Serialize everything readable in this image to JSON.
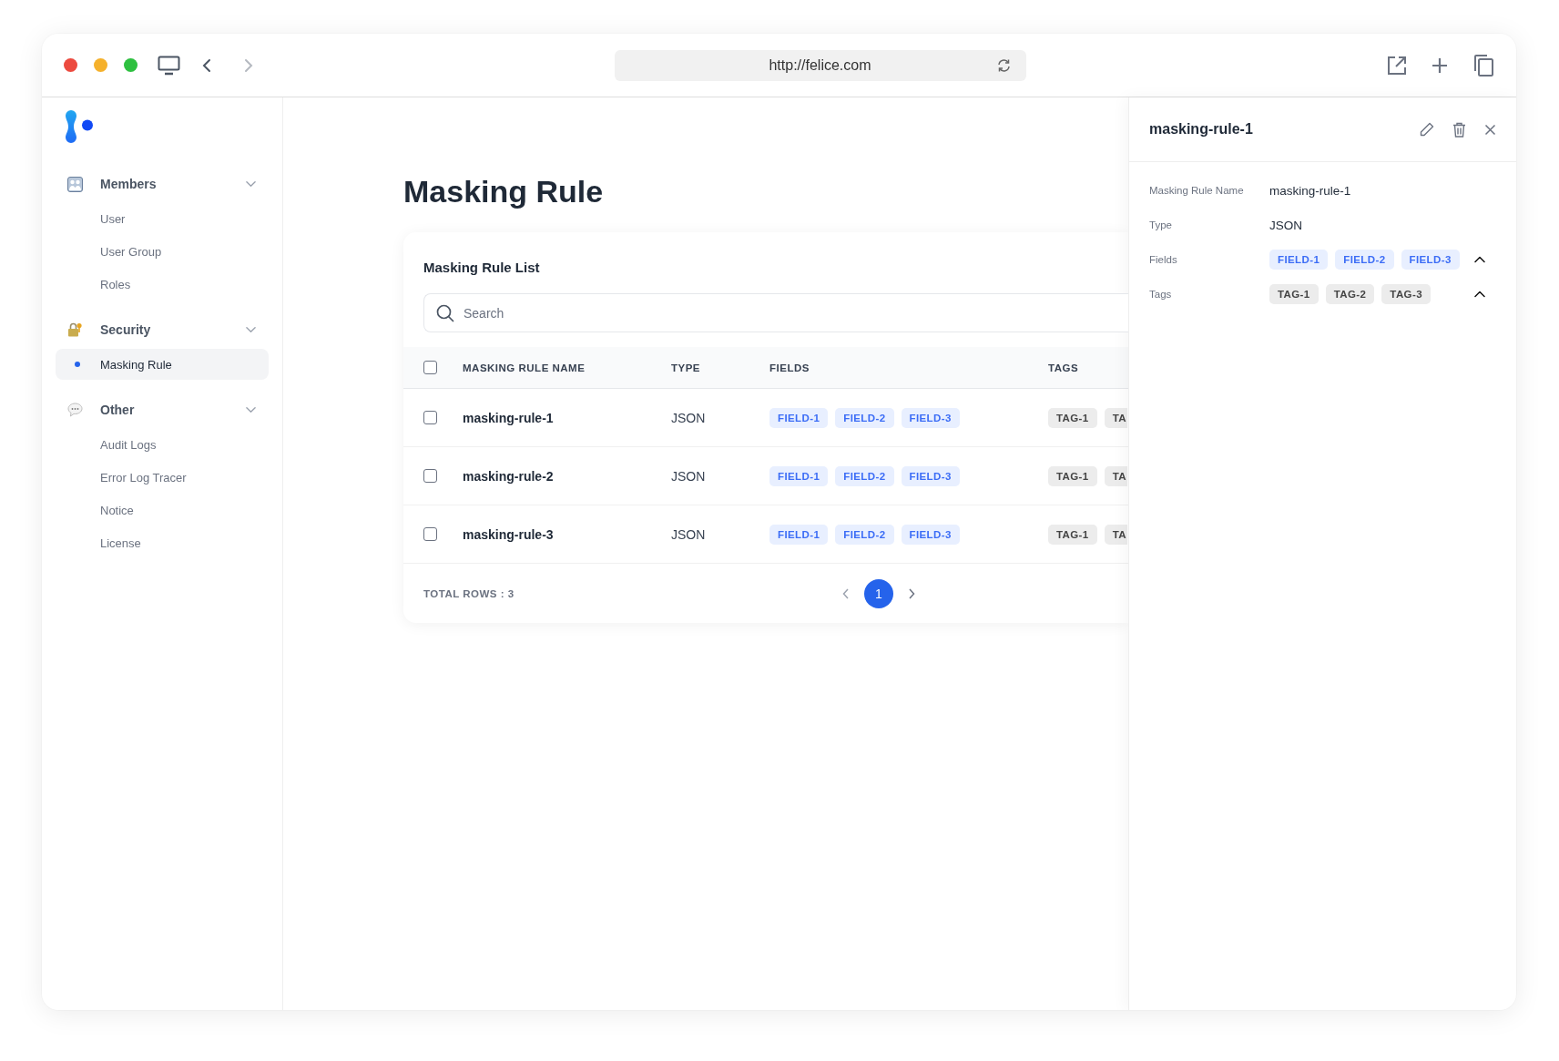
{
  "browser": {
    "url": "http://felice.com"
  },
  "sidebar": {
    "groups": [
      {
        "kind": "members",
        "label": "Members",
        "expanded": true,
        "items": [
          {
            "label": "User",
            "selected": false
          },
          {
            "label": "User Group",
            "selected": false
          },
          {
            "label": "Roles",
            "selected": false
          }
        ]
      },
      {
        "kind": "security",
        "label": "Security",
        "expanded": true,
        "items": [
          {
            "label": "Masking Rule",
            "selected": true
          }
        ]
      },
      {
        "kind": "other",
        "label": "Other",
        "expanded": true,
        "items": [
          {
            "label": "Audit Logs",
            "selected": false
          },
          {
            "label": "Error Log Tracer",
            "selected": false
          },
          {
            "label": "Notice",
            "selected": false
          },
          {
            "label": "License",
            "selected": false
          }
        ]
      }
    ]
  },
  "page": {
    "title": "Masking Rule"
  },
  "list": {
    "title": "Masking Rule List",
    "search": {
      "placeholder": "Search"
    },
    "select_all": {
      "checked": false
    },
    "columns": [
      "MASKING RULE NAME",
      "TYPE",
      "FIELDS",
      "TAGS"
    ],
    "rows": [
      {
        "checked": false,
        "name": "masking-rule-1",
        "type": "JSON",
        "fields": [
          "FIELD-1",
          "FIELD-2",
          "FIELD-3"
        ],
        "tags": [
          "TAG-1",
          "TA"
        ]
      },
      {
        "checked": false,
        "name": "masking-rule-2",
        "type": "JSON",
        "fields": [
          "FIELD-1",
          "FIELD-2",
          "FIELD-3"
        ],
        "tags": [
          "TAG-1",
          "TA"
        ]
      },
      {
        "checked": false,
        "name": "masking-rule-3",
        "type": "JSON",
        "fields": [
          "FIELD-1",
          "FIELD-2",
          "FIELD-3"
        ],
        "tags": [
          "TAG-1",
          "TA"
        ]
      }
    ],
    "total": "TOTAL ROWS : 3",
    "pages": [
      {
        "label": "1",
        "selected": true
      }
    ]
  },
  "detail": {
    "title": "masking-rule-1",
    "rows": [
      {
        "kind": "text",
        "label": "Masking Rule Name",
        "value": "masking-rule-1"
      },
      {
        "kind": "text",
        "label": "Type",
        "value": "JSON"
      },
      {
        "kind": "fields",
        "label": "Fields",
        "chips": [
          "FIELD-1",
          "FIELD-2",
          "FIELD-3"
        ],
        "expanded": true
      },
      {
        "kind": "tags",
        "label": "Tags",
        "chips": [
          "TAG-1",
          "TAG-2",
          "TAG-3"
        ],
        "expanded": true
      }
    ]
  }
}
